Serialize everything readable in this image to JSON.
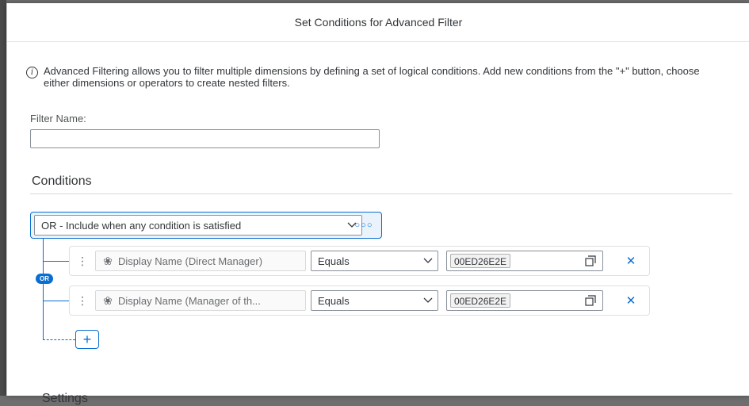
{
  "dialog": {
    "title": "Set Conditions for Advanced Filter"
  },
  "info": {
    "icon": "info-icon",
    "text": "Advanced Filtering allows you to filter multiple dimensions by defining a set of logical conditions. Add new conditions from the \"+\" button, choose either dimensions or operators to create nested filters."
  },
  "filter_name": {
    "label": "Filter Name:",
    "value": "",
    "placeholder": ""
  },
  "conditions": {
    "title": "Conditions",
    "operator": {
      "label": "OR - Include when any condition is satisfied",
      "badge": "OR"
    },
    "rows": [
      {
        "dimension": "Display Name (Direct Manager)",
        "operator": "Equals",
        "value": "00ED26E2E"
      },
      {
        "dimension": "Display Name (Manager of th...",
        "operator": "Equals",
        "value": "00ED26E2E"
      }
    ],
    "add_label": "+"
  },
  "settings": {
    "title": "Settings"
  },
  "colors": {
    "accent": "#0a6ed1",
    "text": "#32363a",
    "border": "#89919a"
  }
}
